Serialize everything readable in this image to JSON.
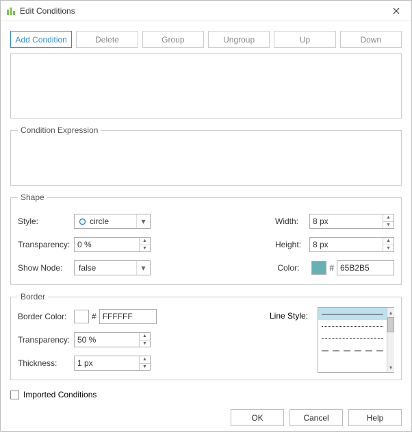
{
  "window": {
    "title": "Edit Conditions"
  },
  "toolbar": {
    "add": "Add Condition",
    "delete": "Delete",
    "group": "Group",
    "ungroup": "Ungroup",
    "up": "Up",
    "down": "Down"
  },
  "expression": {
    "legend": "Condition Expression"
  },
  "shape": {
    "legend": "Shape",
    "style_label": "Style:",
    "style_value": "circle",
    "transp_label": "Transparency:",
    "transp_value": "0 %",
    "shownode_label": "Show Node:",
    "shownode_value": "false",
    "width_label": "Width:",
    "width_value": "8 px",
    "height_label": "Height:",
    "height_value": "8 px",
    "color_label": "Color:",
    "color_hex": "65B2B5",
    "color_swatch": "#65B2B5"
  },
  "border": {
    "legend": "Border",
    "bcolor_label": "Border Color:",
    "bcolor_hex": "FFFFFF",
    "bcolor_swatch": "#FFFFFF",
    "transp_label": "Transparency:",
    "transp_value": "50 %",
    "thick_label": "Thickness:",
    "thick_value": "1 px",
    "linestyle_label": "Line Style:"
  },
  "imported": {
    "label": "Imported Conditions"
  },
  "footer": {
    "ok": "OK",
    "cancel": "Cancel",
    "help": "Help"
  }
}
